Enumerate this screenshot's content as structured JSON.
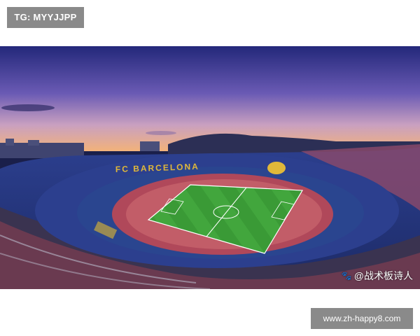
{
  "top_badge": {
    "text": "TG: MYYJJPP"
  },
  "photo": {
    "subject": "stadium-aerial",
    "stand_lettering": "FC BARCELONA",
    "watermark": "@战术板诗人",
    "watermark_icon": "paw-icon",
    "colors": {
      "sky_top": "#2a2f8a",
      "sky_mid": "#7b5fb8",
      "sky_horizon": "#f2b27a",
      "pitch": "#3fa33a",
      "seats_blue": "#2f4a9a",
      "seats_red": "#b2485a"
    }
  },
  "bottom_badge": {
    "text": "www.zh-happy8.com"
  }
}
